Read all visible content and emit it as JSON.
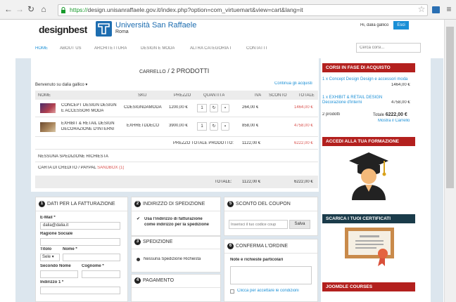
{
  "browser": {
    "url_scheme": "https://",
    "url_rest": "design.unisanraffaele.gov.it/index.php?option=com_virtuemart&view=cart&lang=it"
  },
  "header": {
    "brand": "designbest",
    "uni_name": "Università San Raffaele",
    "uni_city": "Roma",
    "greeting": "Hi, dalia gallico",
    "logout": "Esci"
  },
  "nav": {
    "items": [
      "HOME",
      "ABOUT US",
      "ARCHITETTURA",
      "DESIGN E MODA",
      "ALTRA CATEGORIA I",
      "CONTATTI"
    ],
    "search_placeholder": "Cerca corsi..."
  },
  "cart": {
    "title_pre": "CARRELLO",
    "title_sep": " / ",
    "title_count": "2 PRODOTTI",
    "welcome": "Benvenuto su dalia gallico",
    "continue": "Continua gli acquisti",
    "cols": [
      "NOME",
      "SKU",
      "PREZZO",
      "QUANTITÀ",
      "IVA",
      "SCONTO",
      "TOTALE"
    ],
    "rows": [
      {
        "name1": "CONCEPT DESIGN DESIGN",
        "name2": "E ACCESSORI MODA",
        "sku": "CDESIGNDAMODA",
        "price": "1200,00 €",
        "qty": "1",
        "tax": "264,00 €",
        "total": "1464,00 €"
      },
      {
        "name1": "EXHIBIT & RETAIL DESIGN",
        "name2": "DECORAZIONE D'INTERNI",
        "sku": "EXHRETDDECO",
        "price": "3900,00 €",
        "qty": "1",
        "tax": "858,00 €",
        "total": "4758,00 €"
      }
    ],
    "product_total_label": "PREZZO TOTALE PRODOTTO:",
    "product_total_tax": "1122,00 €",
    "product_total": "6222,00 €",
    "shipping": "NESSUNA SPEDIZIONE RICHIESTA",
    "payment_pre": "CARTA DI CREDITO / PAYPAL",
    "payment_sandbox": "SANDBOX (1)",
    "total_label": "TOTALE:",
    "total_tax": "1122,00 €",
    "total": "6222,00 €"
  },
  "billing": {
    "num": "1",
    "title": "DATI PER LA FATTURAZIONE",
    "email_label": "E-Mail *",
    "email_value": "dalia@dalia.it",
    "company_label": "Ragione Sociale",
    "title_label": "Titolo",
    "name_label": "Nome *",
    "title_select": "Sele",
    "middle_label": "Secondo Nome",
    "surname_label": "Cognome *",
    "address_label": "Indirizzo 1 *"
  },
  "shipping_addr": {
    "num": "2",
    "title": "INDIRIZZO DI SPEDIZIONE",
    "checkbox_label1": "Usa l'indirizzo di fatturazione",
    "checkbox_label2": "come indirizzo per la spedizione"
  },
  "shipment": {
    "num": "3",
    "title": "SPEDIZIONE",
    "option": "Nessuna Spedizione Richiesta"
  },
  "payment": {
    "num": "4",
    "title": "PAGAMENTO"
  },
  "coupon": {
    "num": "5",
    "title": "SCONTO DEL COUPON",
    "placeholder": "Inserisci il tuo codice coup",
    "button": "Salva"
  },
  "confirm": {
    "num": "6",
    "title": "CONFERMA L'ORDINE",
    "notes_label": "Note e richieste particolari",
    "terms": "Clicca per accettare le condizioni"
  },
  "sidebar": {
    "courses_title": "CORSI IN FASE DI ACQUISTO",
    "course1_name": "1 x Concept Design Design e accessori moda",
    "course1_price": "1464,00 €",
    "course2_name": "1 x EXHIBIT & RETAIL DESIGN Decorazione d'interni",
    "course2_price": "4758,00 €",
    "count": "2 prodotti",
    "total_label": "Totale",
    "total_value": "6222,00 €",
    "show_cart": "Mostra il Carrello",
    "login_title": "ACCEDI ALLA TUA FORMAZIONE",
    "certs_title": "SCARICA I TUOI CERTIFICATI",
    "joomdle_title": "JOOMDLE COURSES"
  }
}
